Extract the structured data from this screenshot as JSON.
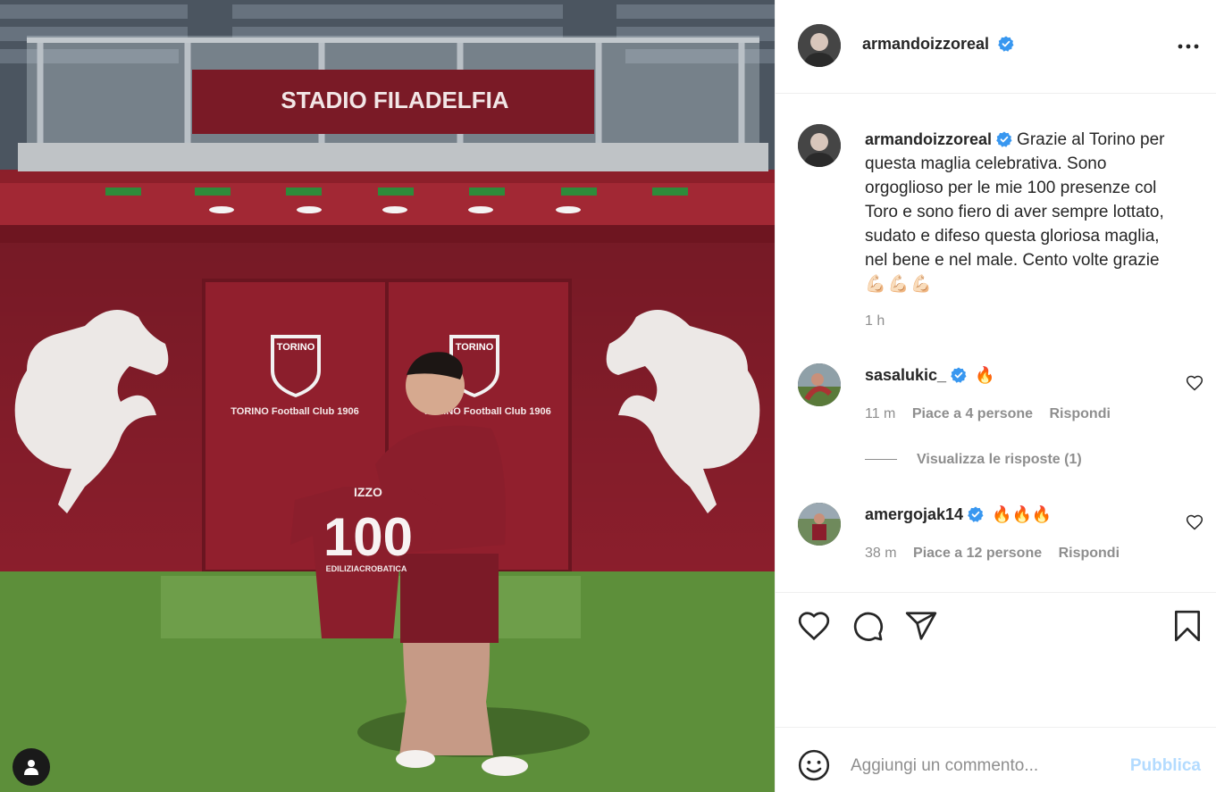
{
  "post": {
    "author": "armandoizzoreal",
    "verified": true,
    "caption": "Grazie al Torino per questa maglia celebrativa. Sono orgoglioso per le mie 100 presenze col Toro e sono fiero di aver sempre lottato, sudato e difeso questa gloriosa maglia, nel bene e nel male. Cento volte grazie",
    "caption_emoji": "💪🏻💪🏻💪🏻",
    "time": "1 h"
  },
  "photo": {
    "stadium_sign": "STADIO FILADELFIA",
    "crest_label": "TORINO",
    "club_text": "TORINO Football Club 1906",
    "shirt_name": "IZZO",
    "shirt_number": "100",
    "shirt_sponsor": "EDILIZIACROBATICA",
    "accent_color": "#8b1e2c"
  },
  "comments": [
    {
      "username": "sasalukic_",
      "verified": true,
      "text": "🔥",
      "time": "11 m",
      "likes": "Piace a 4 persone",
      "reply": "Rispondi",
      "view_replies": "Visualizza le risposte (1)"
    },
    {
      "username": "amergojak14",
      "verified": true,
      "text": "🔥🔥🔥",
      "time": "38 m",
      "likes": "Piace a 12 persone",
      "reply": "Rispondi"
    }
  ],
  "add_comment": {
    "placeholder": "Aggiungi un commento...",
    "publish": "Pubblica"
  },
  "icons": {
    "like": "heart-icon",
    "comment": "comment-icon",
    "share": "paper-plane-icon",
    "save": "bookmark-icon",
    "emoji": "smiley-icon",
    "more": "more-options-icon",
    "user_tag": "user-tag-icon",
    "verified": "verified-badge-icon"
  },
  "colors": {
    "verified_blue": "#3897f0",
    "publish_disabled": "#b3dbff",
    "muted_text": "#8e8e8e"
  }
}
